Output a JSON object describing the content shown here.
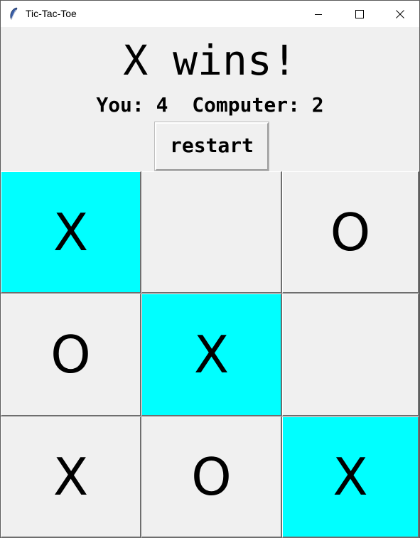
{
  "window": {
    "title": "Tic-Tac-Toe",
    "icon": "feather-icon",
    "controls": [
      "minimize-icon",
      "maximize-icon",
      "close-icon"
    ]
  },
  "status": "X wins!",
  "score": {
    "text": "You: 4  Computer: 2",
    "you": 4,
    "computer": 2
  },
  "restart_label": "restart",
  "colors": {
    "highlight": "#00ffff",
    "cell": "#f0f0f0",
    "background": "#f0f0f0"
  },
  "board": [
    [
      "X",
      "",
      "O"
    ],
    [
      "O",
      "X",
      ""
    ],
    [
      "X",
      "O",
      "X"
    ]
  ],
  "winning_cells": [
    [
      0,
      0
    ],
    [
      1,
      1
    ],
    [
      2,
      2
    ]
  ],
  "cells": {
    "r0c0": "X",
    "r0c1": "",
    "r0c2": "O",
    "r1c0": "O",
    "r1c1": "X",
    "r1c2": "",
    "r2c0": "X",
    "r2c1": "O",
    "r2c2": "X"
  }
}
